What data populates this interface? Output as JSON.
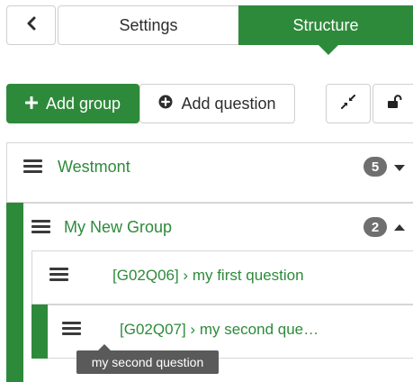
{
  "tabs": {
    "settings_label": "Settings",
    "structure_label": "Structure"
  },
  "toolbar": {
    "add_group_label": "Add group",
    "add_question_label": "Add question"
  },
  "groups": [
    {
      "title": "Westmont",
      "count": "5"
    },
    {
      "title": "My New Group",
      "count": "2"
    }
  ],
  "questions": [
    {
      "label": "[G02Q06] › my first question"
    },
    {
      "label": "[G02Q07] › my second que…"
    }
  ],
  "tooltip": {
    "text": "my second question"
  },
  "colors": {
    "accent": "#2e8a3b",
    "badge": "#6f6f6f",
    "tooltip_bg": "#5a5a5a"
  }
}
